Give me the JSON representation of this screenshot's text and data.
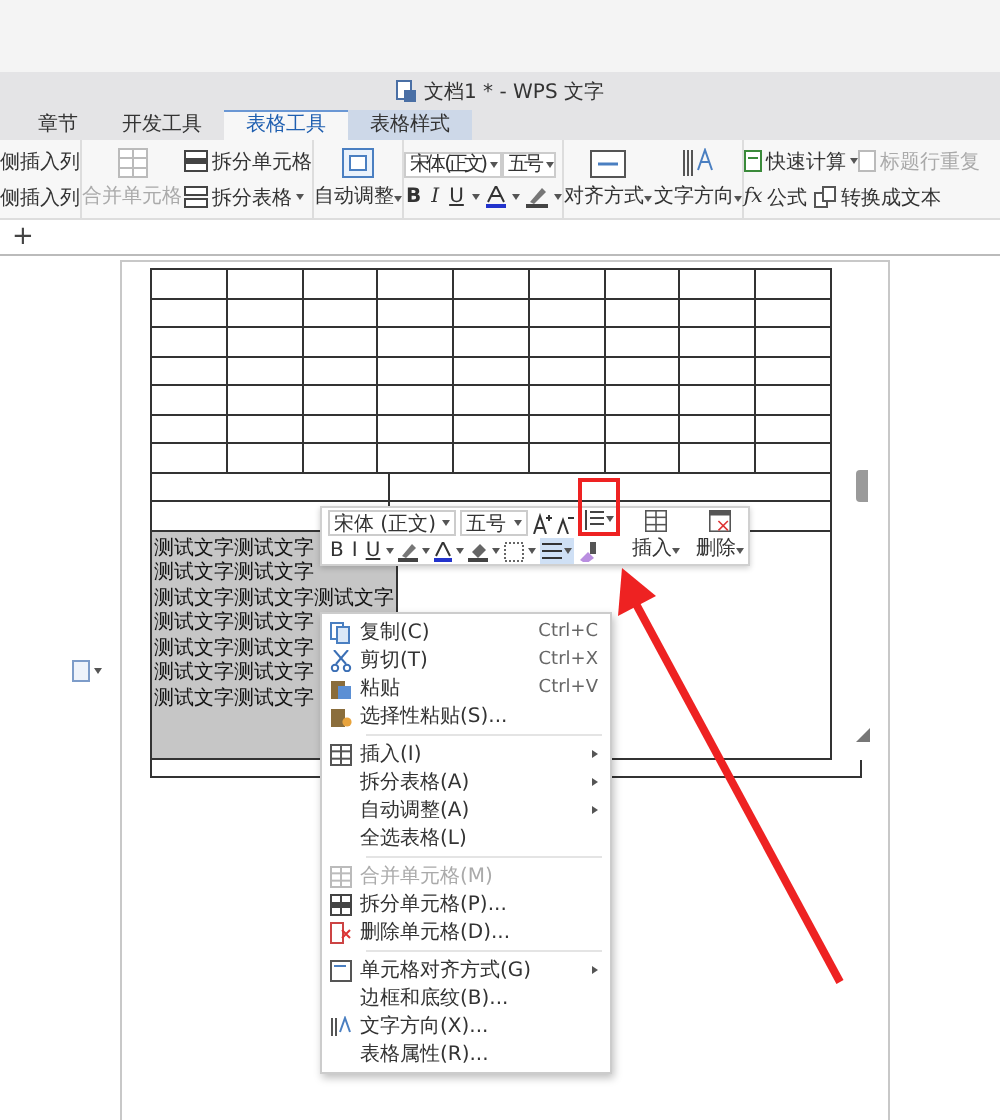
{
  "window": {
    "title": "文档1 * - WPS 文字"
  },
  "tabs": [
    {
      "label": "章节",
      "selected": false
    },
    {
      "label": "开发工具",
      "selected": false
    },
    {
      "label": "表格工具",
      "selected": true
    },
    {
      "label": "表格样式",
      "selected": false
    }
  ],
  "ribbon": {
    "insert_column": [
      "侧插入列",
      "侧插入列"
    ],
    "merge": {
      "label": "合并单元格",
      "disabled": true
    },
    "split_cells": "拆分单元格",
    "split_table": "拆分表格",
    "auto_fit": "自动调整",
    "font": "宋体 (正文)",
    "size": "五号",
    "format": [
      "B",
      "I",
      "U"
    ],
    "align": "对齐方式",
    "text_direction": "文字方向",
    "quick_calc": "快速计算",
    "repeat_header": {
      "label": "标题行重复",
      "disabled": true
    },
    "formula_mark": "fx",
    "formula": "公式",
    "convert": "转换成文本"
  },
  "new_tab": "+",
  "document": {
    "cell": {
      "selected": true,
      "lines": [
        "测试文字测试文字",
        "测试文字测试文字",
        "测试文字测试文字测试文字",
        "测试文字测试文字",
        "测试文字测试文字",
        "测试文字测试文字",
        "测试文字测试文字"
      ]
    }
  },
  "mini_toolbar": {
    "font": "宋体 (正文)",
    "size": "五号",
    "format": [
      "B",
      "I",
      "U"
    ],
    "align": {
      "selected": true
    },
    "insert": "插入",
    "delete": "删除"
  },
  "context_menu": [
    {
      "kind": "item",
      "label": "复制(C)",
      "shortcut": "Ctrl+C",
      "disabled": false,
      "submenu": false
    },
    {
      "kind": "item",
      "label": "剪切(T)",
      "shortcut": "Ctrl+X",
      "disabled": false,
      "submenu": false
    },
    {
      "kind": "item",
      "label": "粘贴",
      "shortcut": "Ctrl+V",
      "disabled": false,
      "submenu": false
    },
    {
      "kind": "item",
      "label": "选择性粘贴(S)...",
      "disabled": false,
      "submenu": false
    },
    {
      "kind": "separator"
    },
    {
      "kind": "item",
      "label": "插入(I)",
      "disabled": false,
      "submenu": true
    },
    {
      "kind": "item",
      "label": "拆分表格(A)",
      "disabled": false,
      "submenu": true
    },
    {
      "kind": "item",
      "label": "自动调整(A)",
      "disabled": false,
      "submenu": true
    },
    {
      "kind": "item",
      "label": "全选表格(L)",
      "disabled": false,
      "submenu": false
    },
    {
      "kind": "separator"
    },
    {
      "kind": "item",
      "label": "合并单元格(M)",
      "disabled": true,
      "submenu": false
    },
    {
      "kind": "item",
      "label": "拆分单元格(P)...",
      "disabled": false,
      "submenu": false
    },
    {
      "kind": "item",
      "label": "删除单元格(D)...",
      "disabled": false,
      "submenu": false
    },
    {
      "kind": "separator"
    },
    {
      "kind": "item",
      "label": "单元格对齐方式(G)",
      "disabled": false,
      "submenu": true
    },
    {
      "kind": "item",
      "label": "边框和底纹(B)...",
      "disabled": false,
      "submenu": false
    },
    {
      "kind": "item",
      "label": "文字方向(X)...",
      "disabled": false,
      "submenu": false
    },
    {
      "kind": "item",
      "label": "表格属性(R)...",
      "disabled": false,
      "submenu": false
    }
  ]
}
